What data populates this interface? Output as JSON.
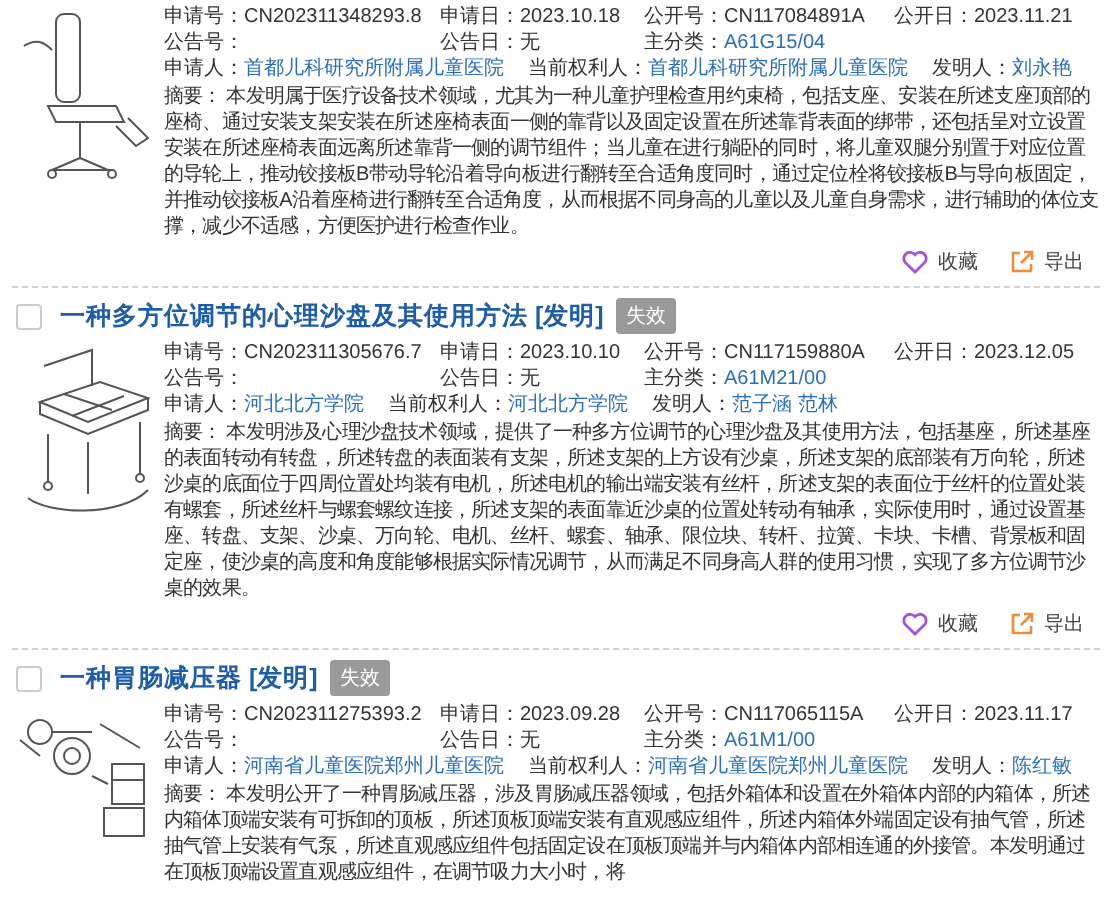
{
  "results": [
    {
      "kind": "chair",
      "meta_grid": [
        {
          "label": "申请号：",
          "value": "CN202311348293.8",
          "link": false
        },
        {
          "label": "申请日：",
          "value": "2023.10.18",
          "link": false
        },
        {
          "label": "公开号：",
          "value": "CN117084891A",
          "link": false
        },
        {
          "label": "公开日：",
          "value": "2023.11.21",
          "link": false
        },
        {
          "label": "公告号："
        },
        {
          "label": "公告日：",
          "value": "无",
          "link": false
        },
        {
          "label": "主分类：",
          "value": "A61G15/04",
          "link": true
        }
      ],
      "parties": [
        {
          "label": "申请人：",
          "value": "首都儿科研究所附属儿童医院",
          "link": true
        },
        {
          "label": "当前权利人：",
          "value": "首都儿科研究所附属儿童医院",
          "link": true
        },
        {
          "label": "发明人：",
          "value": "刘永艳",
          "link": true
        }
      ],
      "abstract": "摘要： 本发明属于医疗设备技术领域，尤其为一种儿童护理检查用约束椅，包括支座、安装在所述支座顶部的座椅、通过安装支架安装在所述座椅表面一侧的靠背以及固定设置在所述靠背表面的绑带，还包括呈对立设置安装在所述座椅表面远离所述靠背一侧的调节组件；当儿童在进行躺卧的同时，将儿童双腿分别置于对应位置的导轮上，推动铰接板B带动导轮沿着导向板进行翻转至合适角度同时，通过定位栓将铰接板B与导向板固定，并推动铰接板A沿着座椅进行翻转至合适角度，从而根据不同身高的儿童以及儿童自身需求，进行辅助的体位支撑，减少不适感，方便医护进行检查作业。",
      "actions": [
        {
          "kind": "favorite",
          "label": "收藏"
        },
        {
          "kind": "export",
          "label": "导出"
        }
      ]
    },
    {
      "checked": false,
      "title": "一种多方位调节的心理沙盘及其使用方法 [发明]",
      "status": "失效",
      "kind": "table",
      "meta_grid": [
        {
          "label": "申请号：",
          "value": "CN202311305676.7",
          "link": false
        },
        {
          "label": "申请日：",
          "value": "2023.10.10",
          "link": false
        },
        {
          "label": "公开号：",
          "value": "CN117159880A",
          "link": false
        },
        {
          "label": "公开日：",
          "value": "2023.12.05",
          "link": false
        },
        {
          "label": "公告号："
        },
        {
          "label": "公告日：",
          "value": "无",
          "link": false
        },
        {
          "label": "主分类：",
          "value": "A61M21/00",
          "link": true
        }
      ],
      "parties": [
        {
          "label": "申请人：",
          "value": "河北北方学院",
          "link": true
        },
        {
          "label": "当前权利人：",
          "value": "河北北方学院",
          "link": true
        },
        {
          "label": "发明人：",
          "value": "范子涵 范林",
          "link": true
        }
      ],
      "abstract": "摘要： 本发明涉及心理沙盘技术领域，提供了一种多方位调节的心理沙盘及其使用方法，包括基座，所述基座的表面转动有转盘，所述转盘的表面装有支架，所述支架的上方设有沙桌，所述支架的底部装有万向轮，所述沙桌的底面位于四周位置处均装有电机，所述电机的输出端安装有丝杆，所述支架的表面位于丝杆的位置处装有螺套，所述丝杆与螺套螺纹连接，所述支架的表面靠近沙桌的位置处转动有轴承，实际使用时，通过设置基座、转盘、支架、沙桌、万向轮、电机、丝杆、螺套、轴承、限位块、转杆、拉簧、卡块、卡槽、背景板和固定座，使沙桌的高度和角度能够根据实际情况调节，从而满足不同身高人群的使用习惯，实现了多方位调节沙桌的效果。",
      "actions": [
        {
          "kind": "favorite",
          "label": "收藏"
        },
        {
          "kind": "export",
          "label": "导出"
        }
      ]
    },
    {
      "checked": false,
      "title": "一种胃肠减压器 [发明]",
      "status": "失效",
      "kind": "device",
      "meta_grid": [
        {
          "label": "申请号：",
          "value": "CN202311275393.2",
          "link": false
        },
        {
          "label": "申请日：",
          "value": "2023.09.28",
          "link": false
        },
        {
          "label": "公开号：",
          "value": "CN117065115A",
          "link": false
        },
        {
          "label": "公开日：",
          "value": "2023.11.17",
          "link": false
        },
        {
          "label": "公告号："
        },
        {
          "label": "公告日：",
          "value": "无",
          "link": false
        },
        {
          "label": "主分类：",
          "value": "A61M1/00",
          "link": true
        }
      ],
      "parties": [
        {
          "label": "申请人：",
          "value": "河南省儿童医院郑州儿童医院",
          "link": true
        },
        {
          "label": "当前权利人：",
          "value": "河南省儿童医院郑州儿童医院",
          "link": true
        },
        {
          "label": "发明人：",
          "value": "陈红敏",
          "link": true
        }
      ],
      "abstract": "摘要： 本发明公开了一种胃肠减压器，涉及胃肠减压器领域，包括外箱体和设置在外箱体内部的内箱体，所述内箱体顶端安装有可拆卸的顶板，所述顶板顶端安装有直观感应组件，所述内箱体外端固定设有抽气管，所述抽气管上安装有气泵，所述直观感应组件包括固定设在顶板顶端并与内箱体内部相连通的外接管。本发明通过在顶板顶端设置直观感应组件，在调节吸力大小时，将"
    }
  ]
}
